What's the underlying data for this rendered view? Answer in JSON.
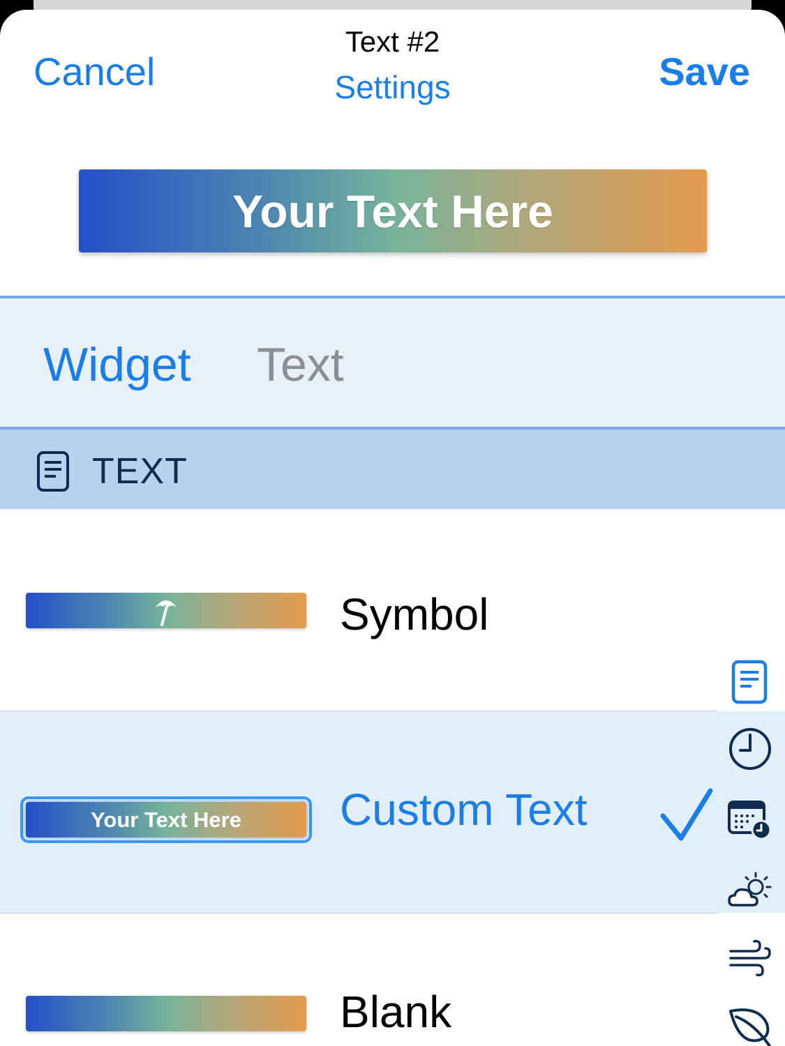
{
  "nav": {
    "cancel_label": "Cancel",
    "title": "Text #2",
    "subtitle": "Settings",
    "save_label": "Save"
  },
  "preview": {
    "text": "Your Text Here"
  },
  "tabs": [
    {
      "label": "Widget",
      "selected": true
    },
    {
      "label": "Text",
      "selected": false
    }
  ],
  "section": {
    "label": "TEXT",
    "icon": "document-icon"
  },
  "rows": [
    {
      "label": "Symbol",
      "thumb_icon": "umbrella-icon",
      "thumb_text": "",
      "selected": false
    },
    {
      "label": "Custom Text",
      "thumb_icon": "",
      "thumb_text": "Your Text Here",
      "selected": true
    },
    {
      "label": "Blank",
      "thumb_icon": "",
      "thumb_text": "",
      "selected": false
    }
  ],
  "index_icons": [
    "document-icon",
    "clock-icon",
    "calendar-clock-icon",
    "partly-cloudy-icon",
    "wind-icon",
    "leaf-icon"
  ],
  "colors": {
    "accent": "#1a7ee6",
    "gradient_start": "#2350c8",
    "gradient_mid": "#76b39a",
    "gradient_end": "#e59b4e",
    "section_header_bg": "#b7d2ee",
    "selected_row_bg": "#e3eefb"
  }
}
